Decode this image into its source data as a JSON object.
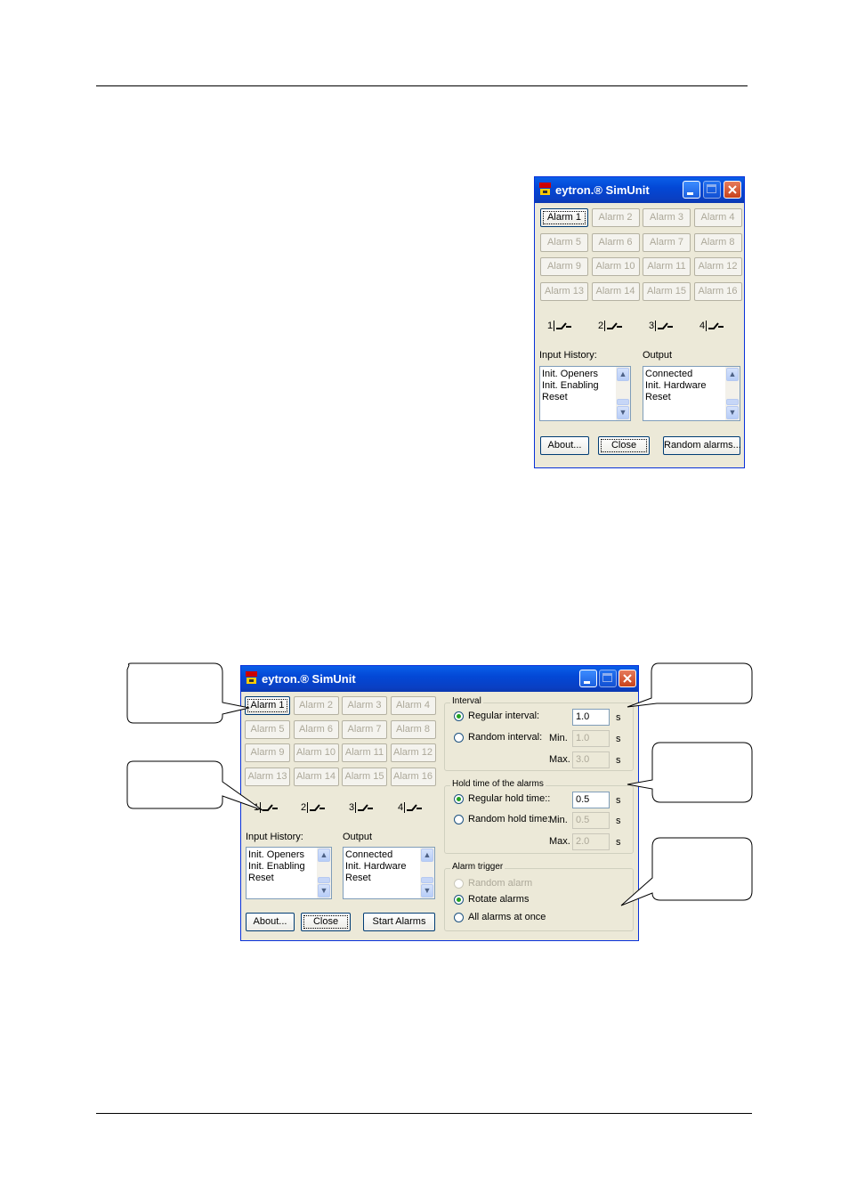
{
  "window_title": "eytron.® SimUnit",
  "alarm_buttons": [
    {
      "label": "Alarm 1"
    },
    {
      "label": "Alarm 2"
    },
    {
      "label": "Alarm 3"
    },
    {
      "label": "Alarm 4"
    },
    {
      "label": "Alarm 5"
    },
    {
      "label": "Alarm 6"
    },
    {
      "label": "Alarm 7"
    },
    {
      "label": "Alarm 8"
    },
    {
      "label": "Alarm 9"
    },
    {
      "label": "Alarm 10"
    },
    {
      "label": "Alarm 11"
    },
    {
      "label": "Alarm 12"
    },
    {
      "label": "Alarm 13"
    },
    {
      "label": "Alarm 14"
    },
    {
      "label": "Alarm 15"
    },
    {
      "label": "Alarm 16"
    }
  ],
  "switches": [
    "1",
    "2",
    "3",
    "4"
  ],
  "input_history": {
    "label": "Input History:",
    "items": [
      "Init. Openers",
      "Init. Enabling",
      "Reset"
    ]
  },
  "output": {
    "label": "Output",
    "items": [
      "Connected",
      "Init. Hardware",
      "Reset"
    ]
  },
  "small_window": {
    "about": "About...",
    "close": "Close",
    "random": "Random alarms..."
  },
  "large_window": {
    "about": "About...",
    "close": "Close",
    "start": "Start Alarms",
    "interval": {
      "title": "Interval",
      "regular_label": "Regular interval:",
      "regular_value": "1.0",
      "regular_unit": "s",
      "random_label": "Random interval:",
      "min_label": "Min.",
      "min_value": "1.0",
      "min_unit": "s",
      "max_label": "Max.",
      "max_value": "3.0",
      "max_unit": "s",
      "selected": "regular"
    },
    "hold": {
      "title": "Hold time of the alarms",
      "regular_label": "Regular hold time::",
      "regular_value": "0.5",
      "regular_unit": "s",
      "random_label": "Random hold time:",
      "min_label": "Min.",
      "min_value": "0.5",
      "min_unit": "s",
      "max_label": "Max.",
      "max_value": "2.0",
      "max_unit": "s",
      "selected": "regular"
    },
    "trigger": {
      "title": "Alarm trigger",
      "options": [
        "Random alarm",
        "Rotate alarms",
        "All alarms at once"
      ],
      "selected": "Rotate alarms"
    }
  },
  "colors": {
    "title_bar": "#0348d6",
    "window_bg": "#ece9d8",
    "radio_selected": "#21a121"
  }
}
